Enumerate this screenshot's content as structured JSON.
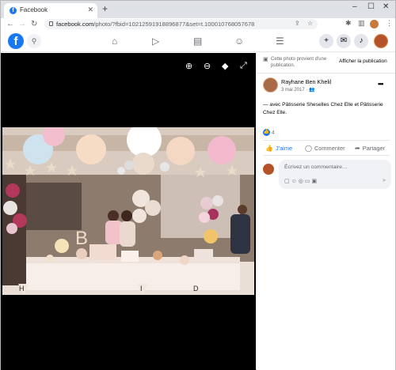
{
  "browser": {
    "tab_title": "Facebook",
    "tab_favicon": "facebook-f",
    "url_host": "facebook.com",
    "url_path": "/photo/?fbid=10212591918896877&set=t.100010768057678"
  },
  "facebook": {
    "logo_letter": "f",
    "nav_icons": [
      "home-icon",
      "watch-icon",
      "marketplace-icon",
      "groups-icon",
      "menu-icon"
    ]
  },
  "viewer": {
    "icons": [
      "zoom-in-icon",
      "zoom-out-icon",
      "tag-icon",
      "fullscreen-icon"
    ],
    "photo_letters": [
      "B",
      "H",
      "I",
      "D"
    ]
  },
  "panel": {
    "notice": "Cette photo provient d'une publication.",
    "view_publication": "Afficher la publication",
    "author": "Rayhane Ben Khelil",
    "date": "3 mai 2017 ·",
    "caption": "— avec Pâtisserie Sheselles Chez Elle et Pâtisserie Chez Elle.",
    "reaction_count": "4",
    "like_label": "J'aime",
    "comment_label": "Commenter",
    "share_label": "Partager",
    "comment_placeholder": "Écrivez un commentaire…"
  },
  "colors": {
    "facebook_blue": "#1877f2",
    "viewer_background": "#000000",
    "secondary_text": "#65676b"
  }
}
